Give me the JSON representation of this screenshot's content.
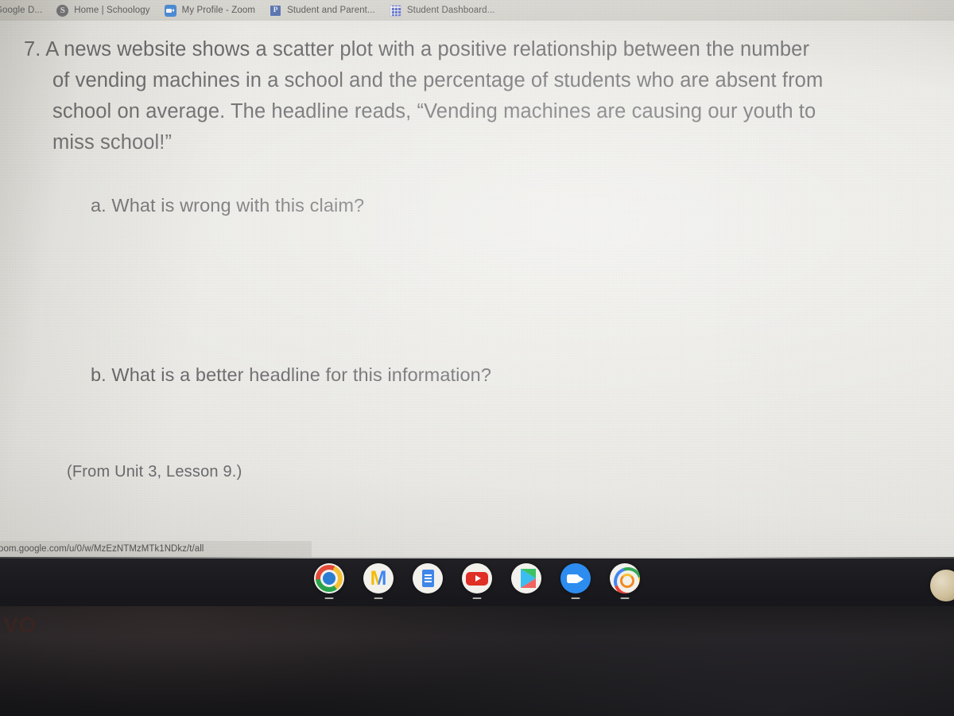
{
  "browser": {
    "tabs": [
      {
        "label": "Google D...",
        "icon": "google-docs-icon",
        "clipped": true
      },
      {
        "label": "Home | Schoology",
        "icon": "schoology-icon",
        "clipped": false
      },
      {
        "label": "My Profile - Zoom",
        "icon": "zoom-icon",
        "clipped": false
      },
      {
        "label": "Student and Parent...",
        "icon": "powerschool-icon",
        "clipped": false
      },
      {
        "label": "Student Dashboard...",
        "icon": "dashboard-grid-icon",
        "clipped": false
      }
    ],
    "status_bar_url": "oom.google.com/u/0/w/MzEzNTMzMTk1NDkz/t/all"
  },
  "worksheet": {
    "question_number": "7.",
    "question_lines": [
      "7. A news website shows a scatter plot with a positive relationship between the number",
      "of vending machines in a school and the percentage of students who are absent from",
      "school on average. The headline reads, “Vending machines are causing our youth to",
      "miss school!”"
    ],
    "sub_question_a": "a. What is wrong with this claim?",
    "sub_question_b": "b. What is a better headline for this information?",
    "source_reference": "(From Unit 3, Lesson 9.)"
  },
  "shelf": {
    "items": [
      {
        "name": "chrome",
        "label": "Chrome",
        "running": true
      },
      {
        "name": "gmail",
        "label": "Gmail",
        "running": true
      },
      {
        "name": "docs",
        "label": "Docs",
        "running": false
      },
      {
        "name": "youtube",
        "label": "YouTube",
        "running": true
      },
      {
        "name": "play-store",
        "label": "Play Store",
        "running": false
      },
      {
        "name": "zoom",
        "label": "Zoom",
        "running": true
      },
      {
        "name": "rings",
        "label": "Fitness",
        "running": true
      }
    ]
  },
  "device": {
    "brand_text": "VO"
  },
  "colors": {
    "screen_background": "#e9e8e3",
    "tabstrip_background": "#d5d3cc",
    "text": "#4c4c4f",
    "shelf_background": "#1c1c20",
    "bezel": "#1d1c1e"
  }
}
